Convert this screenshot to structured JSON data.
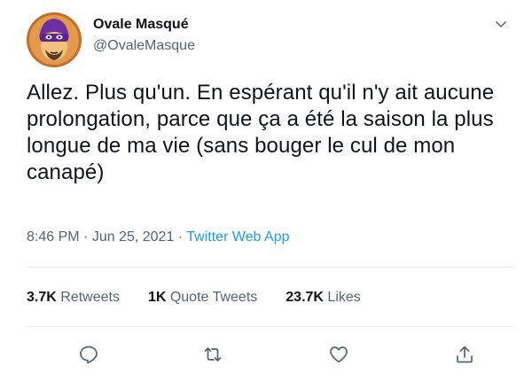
{
  "user": {
    "display_name": "Ovale Masqué",
    "handle": "@OvaleMasque"
  },
  "tweet": {
    "text": "Allez. Plus qu'un. En espérant qu'il n'y ait aucune prolongation, parce que ça a été la saison la plus longue de ma vie (sans bouger le cul de mon canapé)",
    "time": "8:46 PM",
    "sep1": " · ",
    "date": "Jun 25, 2021",
    "sep2": " · ",
    "source": "Twitter Web App"
  },
  "stats": {
    "retweets_count": "3.7K",
    "retweets_label": " Retweets",
    "quotes_count": "1K",
    "quotes_label": " Quote Tweets",
    "likes_count": "23.7K",
    "likes_label": " Likes"
  },
  "icons": {
    "caret": "chevron-down-icon",
    "reply": "reply-icon",
    "retweet": "retweet-icon",
    "like": "heart-icon",
    "share": "share-icon"
  },
  "colors": {
    "text": "#0f1419",
    "secondary": "#536471",
    "link": "#1d9bf0",
    "divider": "#e6ecf0"
  }
}
